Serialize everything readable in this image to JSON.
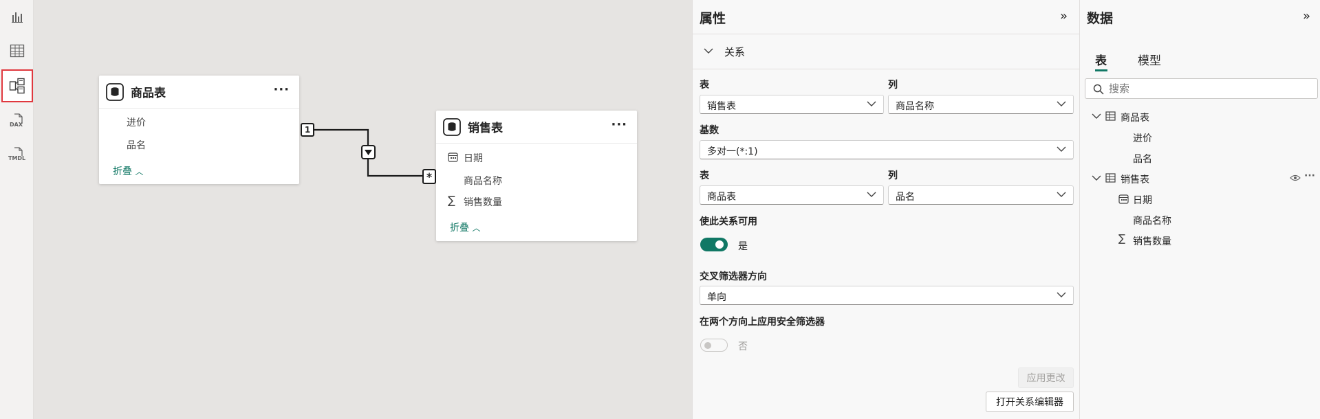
{
  "rail": {
    "items": [
      "report-view",
      "table-view",
      "model-view",
      "dax-query-view",
      "tmdl-view"
    ],
    "labels": {
      "dax": "DAX",
      "tmdl": "TMDL"
    }
  },
  "canvas": {
    "tables": [
      {
        "title": "商品表",
        "fields": [
          "进价",
          "品名"
        ],
        "fold_label": "折叠"
      },
      {
        "title": "销售表",
        "fields": [
          "日期",
          "商品名称",
          "销售数量"
        ],
        "fold_label": "折叠"
      }
    ],
    "relationship": {
      "one_label": "1",
      "many_label": "*"
    }
  },
  "properties": {
    "title": "属性",
    "section": "关系",
    "from_table_label": "表",
    "from_table_value": "销售表",
    "from_col_label": "列",
    "from_col_value": "商品名称",
    "cardinality_label": "基数",
    "cardinality_value": "多对一(*:1)",
    "to_table_label": "表",
    "to_table_value": "商品表",
    "to_col_label": "列",
    "to_col_value": "品名",
    "active_label": "使此关系可用",
    "active_value": "是",
    "crossfilter_label": "交叉筛选器方向",
    "crossfilter_value": "单向",
    "security_label": "在两个方向上应用安全筛选器",
    "security_value": "否",
    "apply_btn": "应用更改",
    "open_editor_btn": "打开关系编辑器"
  },
  "data": {
    "title": "数据",
    "tabs": [
      "表",
      "模型"
    ],
    "search_placeholder": "搜索",
    "tree": [
      {
        "name": "商品表",
        "fields": [
          "进价",
          "品名"
        ]
      },
      {
        "name": "销售表",
        "fields": [
          "日期",
          "商品名称",
          "销售数量"
        ]
      }
    ]
  },
  "colors": {
    "accent": "#117865",
    "selected_border": "#e0383e"
  }
}
